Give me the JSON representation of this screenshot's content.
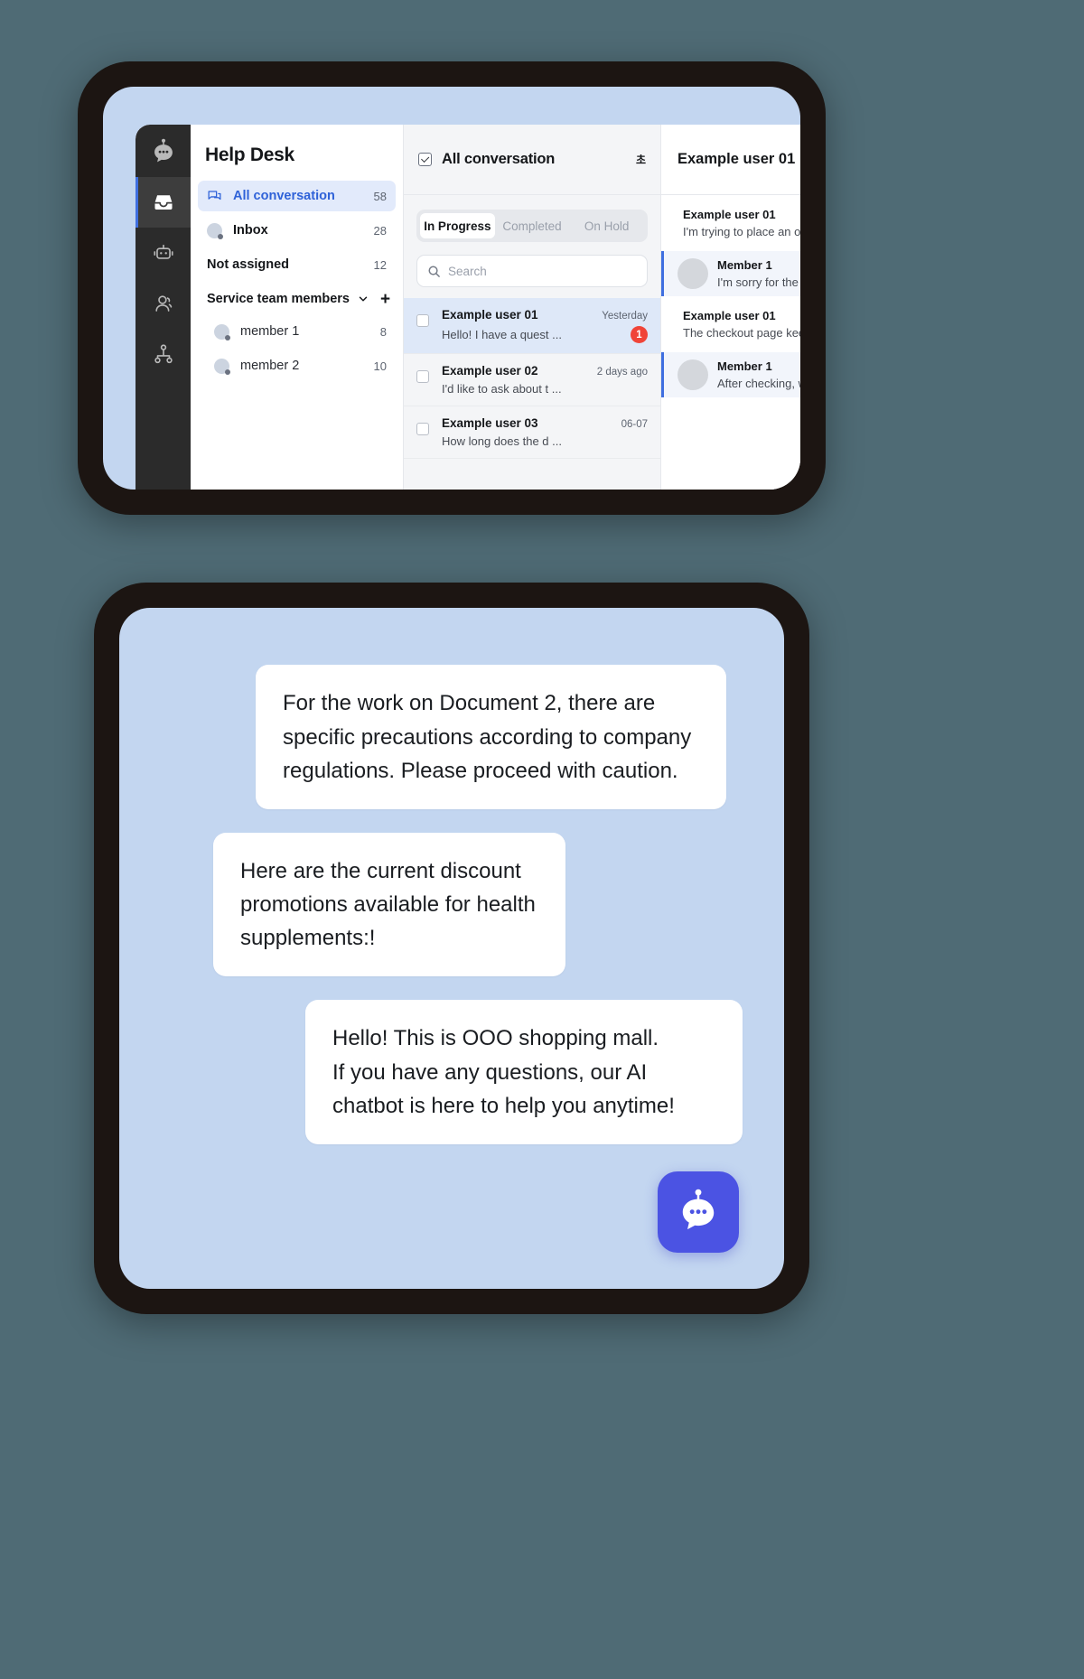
{
  "app": {
    "title": "Help Desk",
    "rail": [
      {
        "icon": "chatbot-logo-icon",
        "name": "rail-logo"
      },
      {
        "icon": "inbox-icon",
        "name": "rail-item-inbox",
        "active": true
      },
      {
        "icon": "bot-icon",
        "name": "rail-item-bot"
      },
      {
        "icon": "user-icon",
        "name": "rail-item-users"
      },
      {
        "icon": "org-chart-icon",
        "name": "rail-item-org"
      }
    ],
    "nav": {
      "items": [
        {
          "label": "All conversation",
          "count": "58",
          "selected": true,
          "icon": "conversation-icon"
        },
        {
          "label": "Inbox",
          "count": "28",
          "selected": false,
          "icon": "avatar-status-icon"
        },
        {
          "label": "Not assigned",
          "count": "12",
          "selected": false,
          "icon": "none"
        }
      ],
      "group": {
        "label": "Service team members",
        "chevron": "chevron-down-icon",
        "add": "+"
      },
      "members": [
        {
          "label": "member 1",
          "count": "8"
        },
        {
          "label": "member 2",
          "count": "10"
        }
      ]
    },
    "conversations": {
      "header_title": "All conversation",
      "header_extra": "초",
      "tabs": [
        {
          "label": "In Progress",
          "active": true
        },
        {
          "label": "Completed",
          "active": false
        },
        {
          "label": "On Hold",
          "active": false
        }
      ],
      "search_placeholder": "Search",
      "items": [
        {
          "name": "Example user 01",
          "time": "Yesterday",
          "preview": "Hello! I have a quest ...",
          "badge": "1",
          "selected": true
        },
        {
          "name": "Example user 02",
          "time": "2 days ago",
          "preview": "I'd like to ask about t ...",
          "badge": "",
          "selected": false
        },
        {
          "name": "Example user 03",
          "time": "06-07",
          "preview": "How long does the d ...",
          "badge": "",
          "selected": false
        }
      ]
    },
    "detail": {
      "title": "Example user 01",
      "messages": [
        {
          "sender": "Example user 01",
          "text": "I'm trying to place an order",
          "role": "user"
        },
        {
          "sender": "Member 1",
          "text": "I'm sorry for the inconvenience",
          "role": "agent"
        },
        {
          "sender": "Example user 01",
          "text": "The checkout page keeps failing",
          "role": "user"
        },
        {
          "sender": "Member 1",
          "text": "After checking, we found",
          "role": "agent"
        }
      ]
    }
  },
  "widget": {
    "messages": [
      "For the work on Document 2, there are specific precautions according to company regulations. Please proceed with caution.",
      "Here are the current discount promotions available for health supplements:!",
      "Hello! This is OOO shopping mall.\nIf you have any questions, our AI chatbot is here to help you anytime!"
    ],
    "fab_icon": "chatbot-icon"
  },
  "colors": {
    "background": "#4f6b75",
    "frame": "#1c1512",
    "screen": "#c3d6f0",
    "accent": "#3f6fe0",
    "fab": "#4b53e3",
    "badge": "#f04438"
  }
}
